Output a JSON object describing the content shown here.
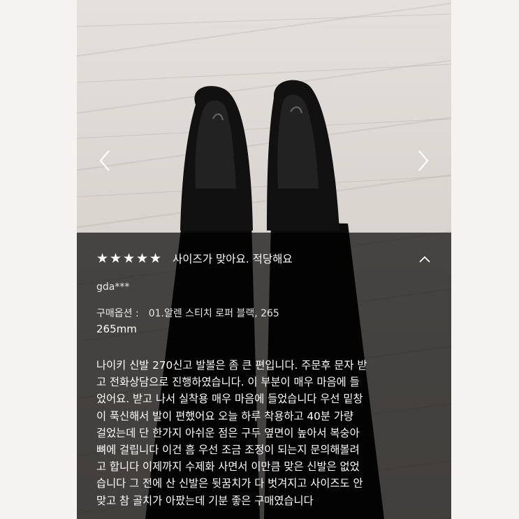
{
  "review": {
    "stars": [
      "★",
      "★",
      "★",
      "★",
      "★"
    ],
    "summary": "사이즈가 맞아요. 적당해요",
    "user_id": "gda***",
    "option_label": "구매옵션 :",
    "option_value": "01.알렌 스티치 로퍼 블랙, 265",
    "size_value": "265mm",
    "body_lines": [
      "나이키 신발 270신고 발볼은 좀 큰 편입니다. 주문후 문자 받",
      "고 전화상담으로 진행하였습니다. 이 부분이 매우 마음에 들",
      "었어요. 받고 나서 실착용 매우 마음에 들었습니다 우선 밑창",
      "이 푹신해서 발이 편했어요 오늘 하루 착용하고 40분 가량",
      "걸었는데 단 한가지 아쉬운 점은 구두 옆면이 높아서 복숭아",
      "뼈에 걸립니다 이건 흠 우선 조금 조정이 되는지 문의해볼려",
      "고 합니다 이제까지 수제화 사면서 이만큼 맞은 신발은 없었",
      "습니다 그 전에 산 신발은 뒷꿈치가 다 벗겨지고 사이즈도 안",
      "맞고 참 골치가 아팠는데 기분 좋은 구매였습니다"
    ]
  },
  "icons": {
    "prev": "chevron-left-icon",
    "next": "chevron-right-icon",
    "collapse": "chevron-up-icon"
  },
  "colors": {
    "overlay": "#000000",
    "text": "#ffffff",
    "floor": "#d8d3cd",
    "side": "#f4f3f1"
  }
}
